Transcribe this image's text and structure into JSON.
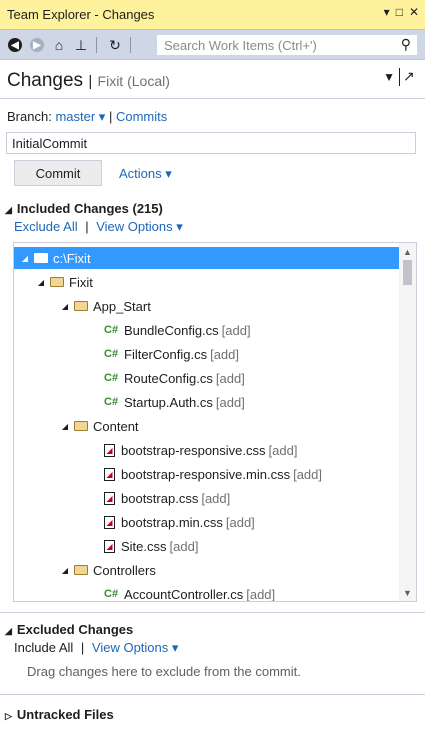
{
  "window": {
    "title": "Team Explorer - Changes",
    "buttons": [
      "▾",
      "□",
      "✕"
    ]
  },
  "toolbar": {
    "icons": [
      "back-icon",
      "forward-icon",
      "home-icon",
      "pin-icon",
      "refresh-icon"
    ],
    "search_placeholder": "Search Work Items (Ctrl+')"
  },
  "header": {
    "title": "Changes",
    "separator": "|",
    "subtitle": "Fixit (Local)"
  },
  "branch": {
    "label": "Branch:",
    "value": "master",
    "separator": "|",
    "commits_link": "Commits"
  },
  "commit_message": {
    "value": "InitialCommit"
  },
  "commit_button": {
    "label": "Commit"
  },
  "actions_link": {
    "label": "Actions"
  },
  "included": {
    "title": "Included Changes (215)",
    "exclude_all": "Exclude All",
    "separator": "|",
    "view_options": "View Options"
  },
  "tree": {
    "rows": [
      {
        "name": "c:\\Fixit",
        "tag": "",
        "type": "folder"
      },
      {
        "name": "Fixit",
        "tag": "",
        "type": "folder"
      },
      {
        "name": "App_Start",
        "tag": "",
        "type": "folder"
      },
      {
        "name": "BundleConfig.cs",
        "tag": "[add]",
        "type": "cs"
      },
      {
        "name": "FilterConfig.cs",
        "tag": "[add]",
        "type": "cs"
      },
      {
        "name": "RouteConfig.cs",
        "tag": "[add]",
        "type": "cs"
      },
      {
        "name": "Startup.Auth.cs",
        "tag": "[add]",
        "type": "cs"
      },
      {
        "name": "Content",
        "tag": "",
        "type": "folder"
      },
      {
        "name": "bootstrap-responsive.css",
        "tag": "[add]",
        "type": "css"
      },
      {
        "name": "bootstrap-responsive.min.css",
        "tag": "[add]",
        "type": "css"
      },
      {
        "name": "bootstrap.css",
        "tag": "[add]",
        "type": "css"
      },
      {
        "name": "bootstrap.min.css",
        "tag": "[add]",
        "type": "css"
      },
      {
        "name": "Site.css",
        "tag": "[add]",
        "type": "css"
      },
      {
        "name": "Controllers",
        "tag": "",
        "type": "folder"
      },
      {
        "name": "AccountController.cs",
        "tag": "[add]",
        "type": "cs"
      }
    ]
  },
  "excluded": {
    "title": "Excluded Changes",
    "include_all": "Include All",
    "separator": "|",
    "view_options": "View Options",
    "hint": "Drag changes here to exclude from the commit."
  },
  "untracked": {
    "title": "Untracked Files"
  }
}
